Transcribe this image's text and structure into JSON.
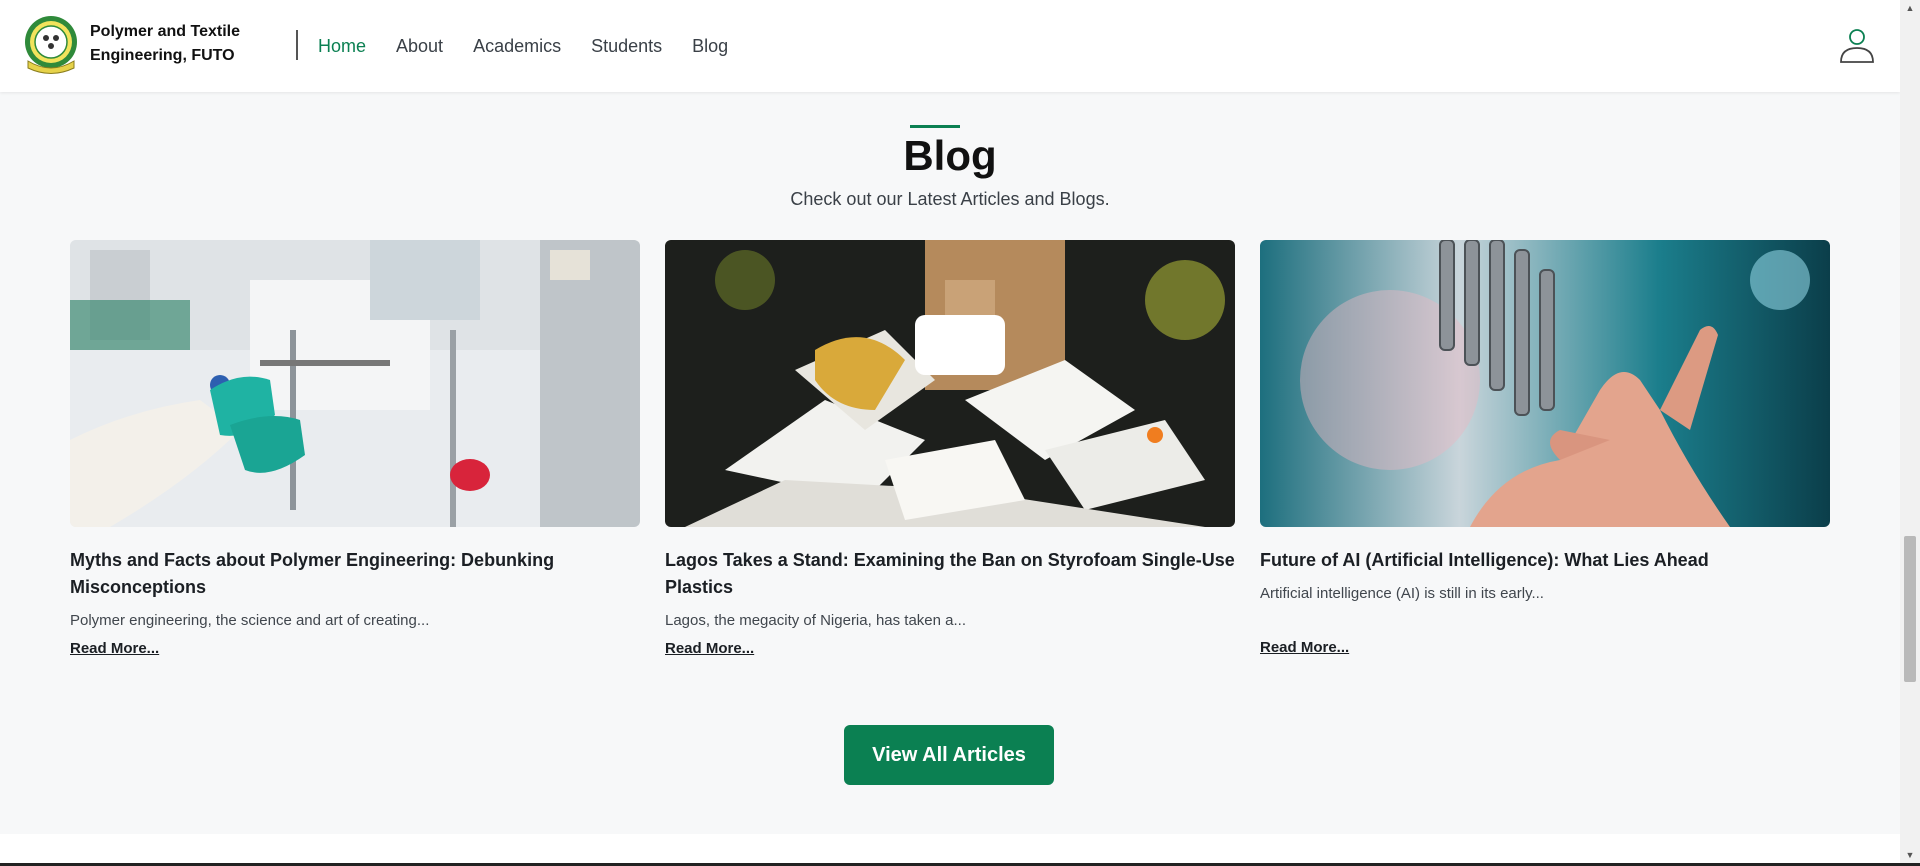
{
  "header": {
    "brand_line1": "Polymer and Textile",
    "brand_line2": "Engineering, FUTO",
    "nav": [
      {
        "label": "Home",
        "active": true
      },
      {
        "label": "About"
      },
      {
        "label": "Academics"
      },
      {
        "label": "Students"
      },
      {
        "label": "Blog"
      }
    ],
    "user_icon": "user-icon"
  },
  "section": {
    "title": "Blog",
    "subtitle": "Check out our Latest Articles and Blogs."
  },
  "articles": [
    {
      "title": "Myths and Facts about Polymer Engineering: Debunking Misconceptions",
      "excerpt": "Polymer engineering, the science and art of creating...",
      "read_more": "Read More..."
    },
    {
      "title": "Lagos Takes a Stand: Examining the Ban on Styrofoam Single-Use Plastics",
      "excerpt": "Lagos, the megacity of Nigeria, has taken a...",
      "read_more": "Read More..."
    },
    {
      "title": "Future of AI (Artificial Intelligence): What Lies Ahead",
      "excerpt": "Artificial intelligence (AI) is still in its early...",
      "read_more": "Read More..."
    }
  ],
  "cta": {
    "label": "View All Articles"
  },
  "colors": {
    "accent": "#0b8052",
    "background": "#f7f8f9",
    "text": "#1b1f24"
  }
}
